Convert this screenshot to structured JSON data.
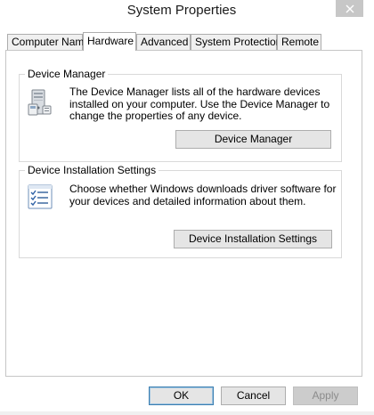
{
  "window": {
    "title": "System Properties"
  },
  "tabs": [
    {
      "label": "Computer Name",
      "active": false
    },
    {
      "label": "Hardware",
      "active": true
    },
    {
      "label": "Advanced",
      "active": false
    },
    {
      "label": "System Protection",
      "active": false
    },
    {
      "label": "Remote",
      "active": false
    }
  ],
  "device_manager": {
    "title": "Device Manager",
    "description": "The Device Manager lists all of the hardware devices installed on your computer. Use the Device Manager to change the properties of any device.",
    "button": "Device Manager",
    "icon": "computer-device-icon"
  },
  "device_installation": {
    "title": "Device Installation Settings",
    "description": "Choose whether Windows downloads driver software for your devices and detailed information about them.",
    "button": "Device Installation Settings",
    "icon": "checklist-icon"
  },
  "footer": {
    "ok": "OK",
    "cancel": "Cancel",
    "apply": "Apply"
  }
}
